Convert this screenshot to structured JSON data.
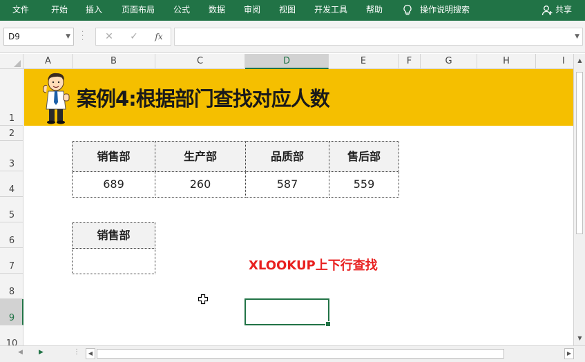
{
  "ribbon": {
    "tabs": [
      "文件",
      "开始",
      "插入",
      "页面布局",
      "公式",
      "数据",
      "审阅",
      "视图",
      "开发工具",
      "帮助"
    ],
    "tell_me": "操作说明搜索",
    "share": "共享"
  },
  "formula_bar": {
    "name_box": "D9",
    "fx": "fx",
    "formula": ""
  },
  "columns": [
    "A",
    "B",
    "C",
    "D",
    "E",
    "F",
    "G",
    "H",
    "I"
  ],
  "active_column": "D",
  "rows": [
    "1",
    "2",
    "3",
    "4",
    "5",
    "6",
    "7",
    "8",
    "9",
    "10"
  ],
  "active_row": "9",
  "sheet": {
    "banner_title": "案例4:根据部门查找对应人数",
    "table": {
      "headers": [
        "销售部",
        "生产部",
        "品质部",
        "售后部"
      ],
      "values": [
        "689",
        "260",
        "587",
        "559"
      ]
    },
    "lookup": {
      "header": "销售部",
      "result": ""
    },
    "note": "XLOOKUP上下行查找"
  },
  "colors": {
    "ribbon": "#217346",
    "banner": "#f5bf00",
    "note": "#e8201f"
  }
}
